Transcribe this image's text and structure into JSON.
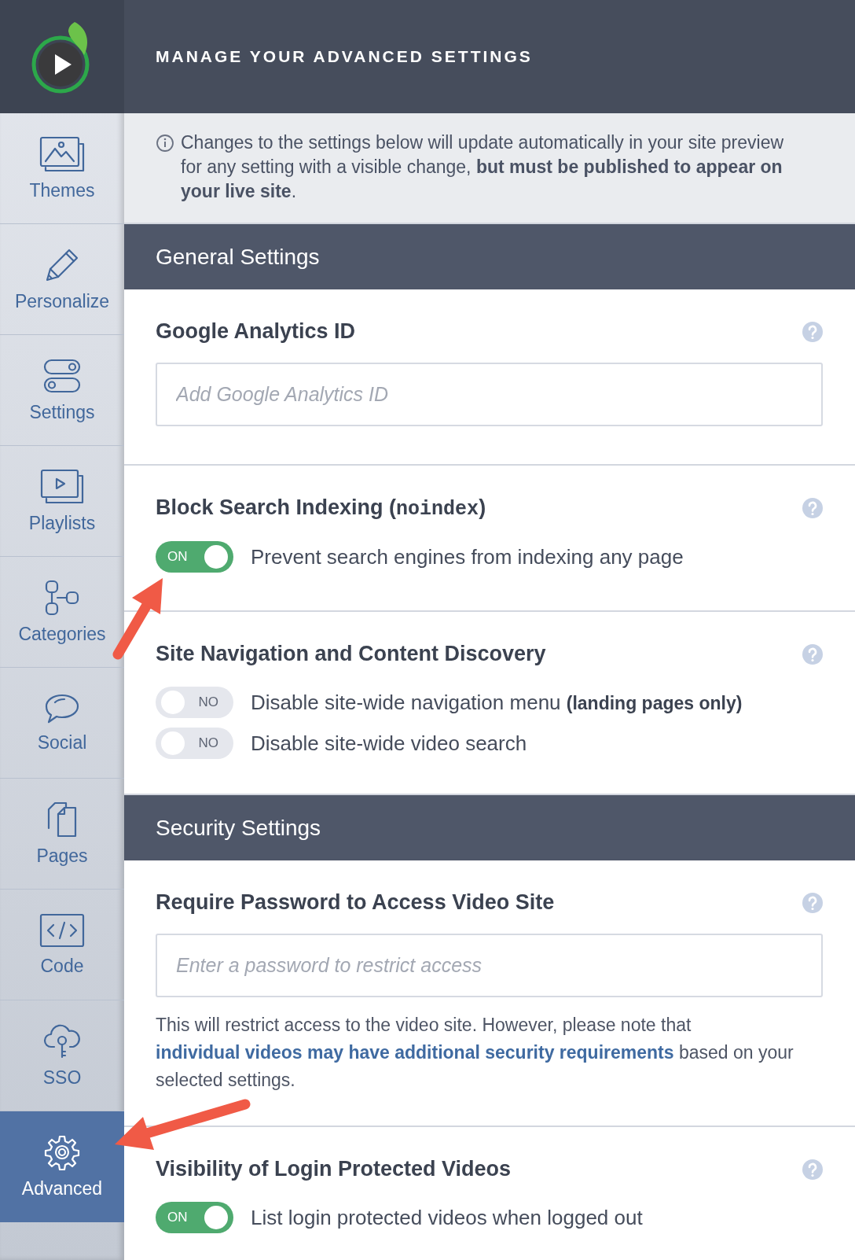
{
  "sidebar": {
    "items": [
      {
        "label": "Themes",
        "kind": "themes",
        "selected": false
      },
      {
        "label": "Personalize",
        "kind": "personalize",
        "selected": false
      },
      {
        "label": "Settings",
        "kind": "settings",
        "selected": false
      },
      {
        "label": "Playlists",
        "kind": "playlists",
        "selected": false
      },
      {
        "label": "Categories",
        "kind": "categories",
        "selected": false
      },
      {
        "label": "Social",
        "kind": "social",
        "selected": false
      },
      {
        "label": "Pages",
        "kind": "pages",
        "selected": false
      },
      {
        "label": "Code",
        "kind": "code",
        "selected": false
      },
      {
        "label": "SSO",
        "kind": "sso",
        "selected": false
      },
      {
        "label": "Advanced",
        "kind": "advanced",
        "selected": true
      }
    ]
  },
  "header": {
    "title": "MANAGE YOUR ADVANCED SETTINGS"
  },
  "notice": {
    "text": "Changes to the settings below will update automatically in your site preview for any setting with a visible change, **but must be published to appear on your live site**."
  },
  "sections": [
    {
      "title": "General Settings",
      "settings": [
        {
          "kind": "field",
          "title_parts": [
            {
              "text": "Google Analytics ID",
              "code": false
            }
          ],
          "placeholder": "Add Google Analytics ID"
        },
        {
          "kind": "toggles",
          "title_parts": [
            {
              "text": "Block Search Indexing (",
              "code": false
            },
            {
              "text": "noindex",
              "code": true
            },
            {
              "text": ")",
              "code": false
            }
          ],
          "toggles": [
            {
              "on": true,
              "state_text": "ON",
              "label": "Prevent search engines from indexing any page"
            }
          ]
        },
        {
          "kind": "toggles",
          "title_parts": [
            {
              "text": "Site Navigation and Content Discovery",
              "code": false
            }
          ],
          "toggles": [
            {
              "on": false,
              "state_text": "NO",
              "label": "Disable site-wide navigation menu **(landing pages only)**"
            },
            {
              "on": false,
              "state_text": "NO",
              "label": "Disable site-wide video search"
            }
          ]
        }
      ]
    },
    {
      "title": "Security Settings",
      "settings": [
        {
          "kind": "field",
          "title_parts": [
            {
              "text": "Require Password to Access Video Site",
              "code": false
            }
          ],
          "placeholder": "Enter a password to restrict access",
          "note": {
            "before": "This will restrict access to the video site. However, please note that",
            "link": "individual videos may have additional security requirements",
            "after": "based on your selected settings."
          }
        },
        {
          "kind": "toggles",
          "title_parts": [
            {
              "text": "Visibility of Login Protected Videos",
              "code": false
            }
          ],
          "toggles": [
            {
              "on": true,
              "state_text": "ON",
              "label": "List login protected videos when logged out"
            }
          ]
        }
      ]
    }
  ]
}
